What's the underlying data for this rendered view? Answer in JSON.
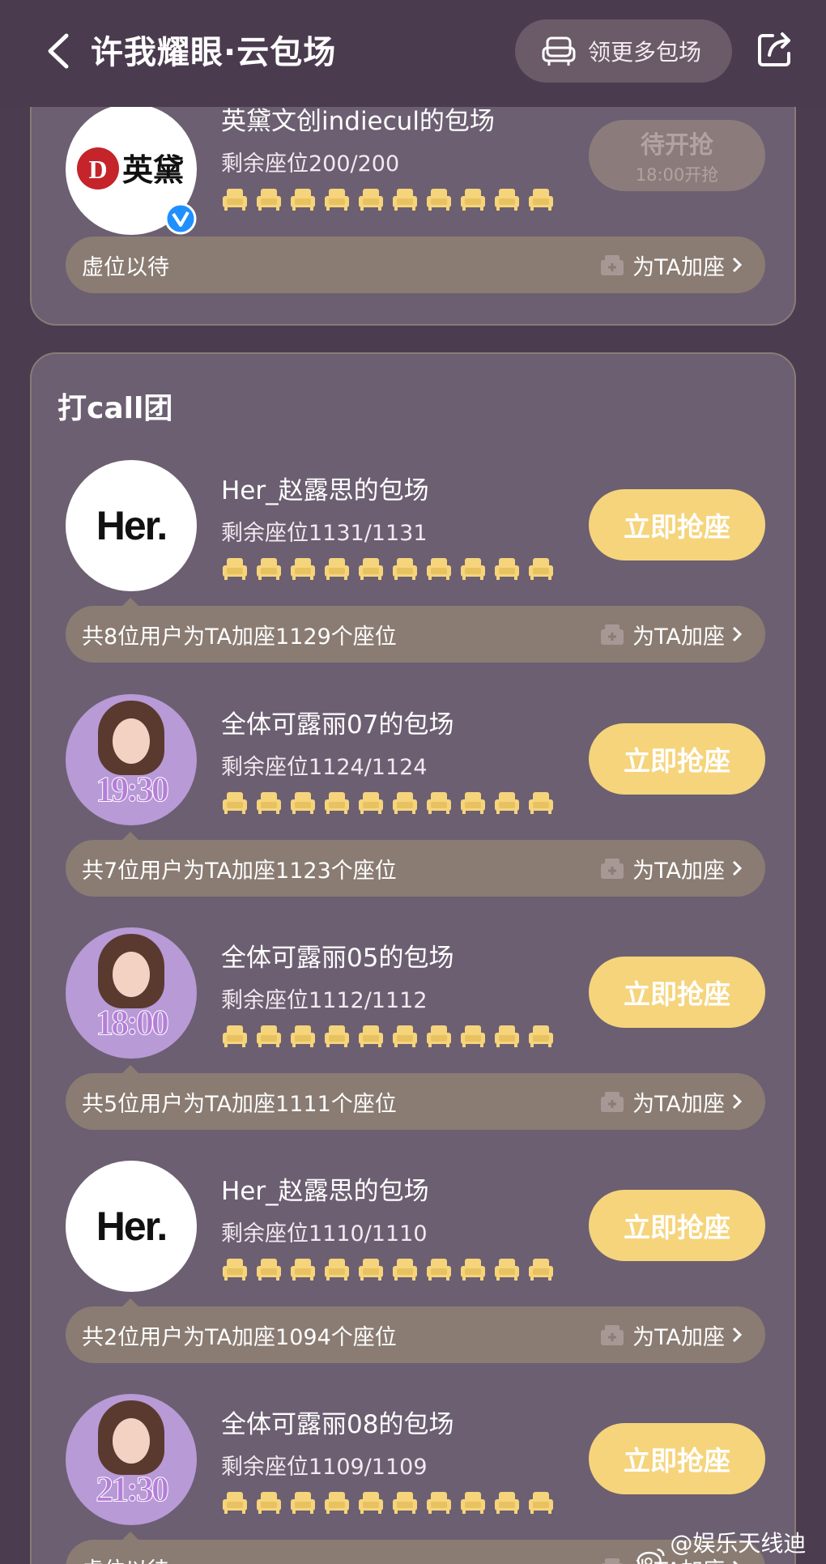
{
  "header": {
    "title": "许我耀眼·云包场",
    "more_button": "领更多包场"
  },
  "top_entry": {
    "avatar_text": "英黛",
    "title": "英黛文创indiecul的包场",
    "seats": "剩余座位200/200",
    "status_main": "待开抢",
    "status_sub": "18:00开抢",
    "info": "虚位以待",
    "add_seat": "为TA加座"
  },
  "section": {
    "title": "打call团"
  },
  "entries": [
    {
      "avatar_text": "Her.",
      "title": "Her_赵露思的包场",
      "seats": "剩余座位1131/1131",
      "button": "立即抢座",
      "info": "共8位用户为TA加座1129个座位",
      "add_seat": "为TA加座"
    },
    {
      "avatar_text": "19:30",
      "title": "全体可露丽07的包场",
      "seats": "剩余座位1124/1124",
      "button": "立即抢座",
      "info": "共7位用户为TA加座1123个座位",
      "add_seat": "为TA加座"
    },
    {
      "avatar_text": "18:00",
      "title": "全体可露丽05的包场",
      "seats": "剩余座位1112/1112",
      "button": "立即抢座",
      "info": "共5位用户为TA加座1111个座位",
      "add_seat": "为TA加座"
    },
    {
      "avatar_text": "Her.",
      "title": "Her_赵露思的包场",
      "seats": "剩余座位1110/1110",
      "button": "立即抢座",
      "info": "共2位用户为TA加座1094个座位",
      "add_seat": "为TA加座"
    },
    {
      "avatar_text": "21:30",
      "title": "全体可露丽08的包场",
      "seats": "剩余座位1109/1109",
      "button": "立即抢座",
      "info": "虚位以待",
      "add_seat": "为TA加座"
    }
  ],
  "watermark": "@娱乐天线迪西",
  "colors": {
    "background": "#4b3d4f",
    "card": "#6c5f71",
    "accent": "#f5d47c",
    "info_bar": "#8a7c73"
  }
}
